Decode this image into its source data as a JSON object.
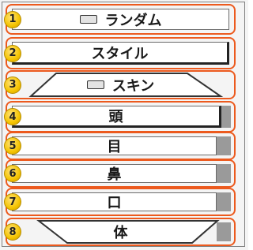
{
  "items": [
    {
      "num": "1",
      "label": "ランダム",
      "icon": "keyboard-icon"
    },
    {
      "num": "2",
      "label": "スタイル"
    },
    {
      "num": "3",
      "label": "スキン",
      "icon": "keyboard-icon"
    },
    {
      "num": "4",
      "label": "頭"
    },
    {
      "num": "5",
      "label": "目"
    },
    {
      "num": "6",
      "label": "鼻"
    },
    {
      "num": "7",
      "label": "口"
    },
    {
      "num": "8",
      "label": "体"
    }
  ],
  "colors": {
    "highlight": "#ec5a1e",
    "badge": "#f5c400"
  }
}
